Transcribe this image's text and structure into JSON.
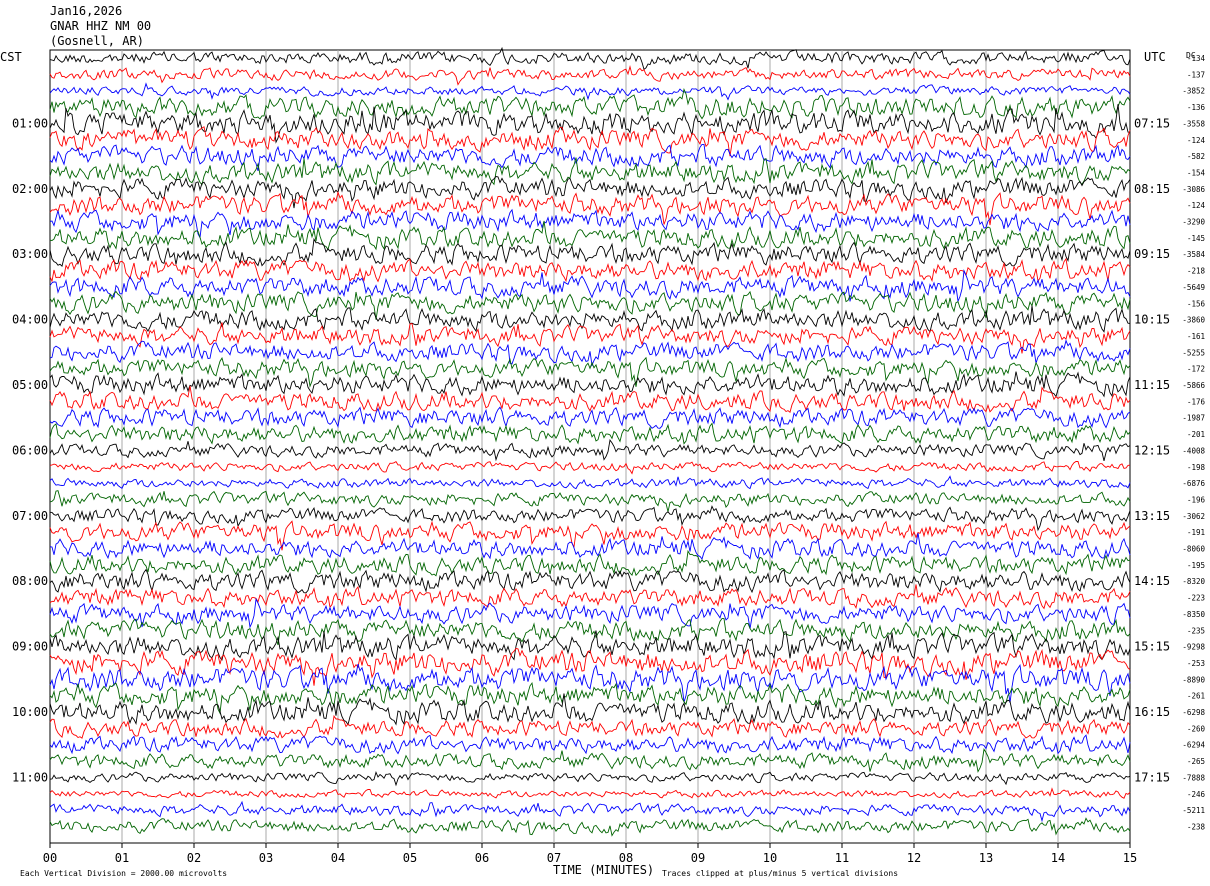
{
  "header": {
    "date": "Jan16,2026",
    "station": "GNAR HHZ NM 00",
    "location": "(Gosnell, AR)"
  },
  "left_axis_label": "CST",
  "right_axis_label": "UTC",
  "dc_label": "DC",
  "footer": {
    "scale_note": "Each Vertical Division = 2000.00 microvolts",
    "xlabel": "TIME (MINUTES)",
    "clip_note": "Traces clipped at plus/minus 5 vertical divisions"
  },
  "colors": {
    "line1": "#000000",
    "line2": "#ff0000",
    "line3": "#0000ff",
    "line4": "#006400",
    "grid": "#aaaaaa"
  },
  "chart_data": {
    "type": "line",
    "description_type": "helicorder",
    "xlim": [
      0,
      15
    ],
    "x_ticks": [
      "00",
      "01",
      "02",
      "03",
      "04",
      "05",
      "06",
      "07",
      "08",
      "09",
      "10",
      "11",
      "12",
      "13",
      "14",
      "15"
    ],
    "traces_per_hour": 4,
    "minutes_per_trace": 15,
    "trace_colors": [
      "#000000",
      "#ff0000",
      "#0000ff",
      "#006400"
    ],
    "hour_labels_cst": [
      "01:00",
      "02:00",
      "03:00",
      "04:00",
      "05:00",
      "06:00",
      "07:00",
      "08:00",
      "09:00",
      "10:00",
      "11:00"
    ],
    "hour_labels_utc": [
      "07:15",
      "08:15",
      "09:15",
      "10:15",
      "11:15",
      "12:15",
      "13:15",
      "14:15",
      "15:15",
      "16:15",
      "17:15"
    ],
    "dc_offsets": [
      "-134",
      "-137",
      "-3852",
      "-136",
      "-3558",
      "-124",
      "-582",
      "-154",
      "-3086",
      "-124",
      "-3290",
      "-145",
      "-3584",
      "-218",
      "-5649",
      "-156",
      "-3860",
      "-161",
      "-5255",
      "-172",
      "-5866",
      "-176",
      "-1987",
      "-201",
      "-4008",
      "-198",
      "-6876",
      "-196",
      "-3062",
      "-191",
      "-8060",
      "-195",
      "-8320",
      "-223",
      "-8350",
      "-235",
      "-9298",
      "-253",
      "-8890",
      "-261",
      "-6298",
      "-260",
      "-6294",
      "-265",
      "-7888",
      "-246",
      "-5211",
      "-238"
    ],
    "trace_amplitude": [
      0.35,
      0.3,
      0.25,
      0.55,
      0.65,
      0.55,
      0.55,
      0.55,
      0.55,
      0.55,
      0.55,
      0.55,
      0.55,
      0.55,
      0.55,
      0.55,
      0.55,
      0.5,
      0.5,
      0.5,
      0.55,
      0.5,
      0.5,
      0.5,
      0.35,
      0.25,
      0.25,
      0.35,
      0.4,
      0.5,
      0.5,
      0.5,
      0.55,
      0.5,
      0.5,
      0.55,
      0.6,
      0.65,
      0.65,
      0.6,
      0.6,
      0.45,
      0.45,
      0.4,
      0.25,
      0.2,
      0.3,
      0.35
    ]
  }
}
